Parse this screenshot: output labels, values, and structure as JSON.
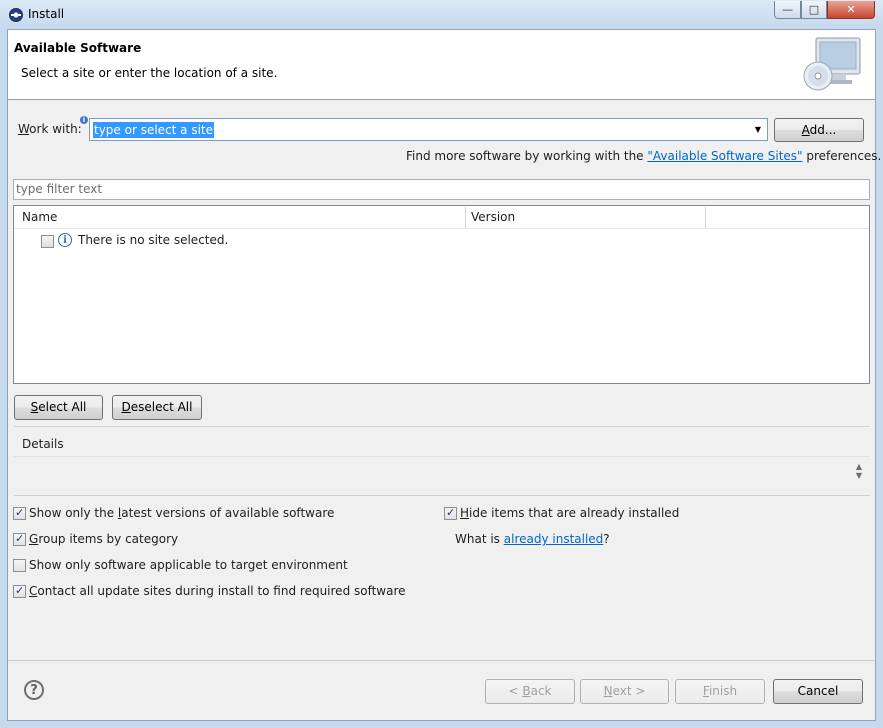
{
  "window": {
    "title": "Install"
  },
  "header": {
    "title": "Available Software",
    "description": "Select a site or enter the location of a site."
  },
  "work_with": {
    "label_accel": "W",
    "label_rest": "ork with:",
    "value": "type or select a site",
    "add_accel": "A",
    "add_rest": "dd..."
  },
  "find_more": {
    "prefix": "Find more software by working with the ",
    "link": "\"Available Software Sites\"",
    "suffix": " preferences."
  },
  "filter": {
    "placeholder": "type filter text"
  },
  "table": {
    "columns": [
      "Name",
      "Version"
    ],
    "empty_message": "There is no site selected."
  },
  "buttons": {
    "select_all_accel": "S",
    "select_all_rest": "elect All",
    "deselect_all_accel": "D",
    "deselect_all_rest": "eselect All",
    "back": "< ",
    "back_accel": "B",
    "back_rest": "ack",
    "next_accel": "N",
    "next_rest": "ext >",
    "finish_accel": "F",
    "finish_rest": "inish",
    "cancel": "Cancel"
  },
  "details": {
    "label": "Details"
  },
  "options": {
    "latest": {
      "pre": "Show only the ",
      "accel": "l",
      "post": "atest versions of available software",
      "checked": true
    },
    "group": {
      "pre": "",
      "accel": "G",
      "post": "roup items by category",
      "checked": true
    },
    "target": {
      "pre": "Show only software applicable to target environment",
      "accel": "",
      "post": "",
      "checked": false
    },
    "contact": {
      "pre": "",
      "accel": "C",
      "post": "ontact all update sites during install to find required software",
      "checked": true
    },
    "hide": {
      "pre": "",
      "accel": "H",
      "post": "ide items that are already installed",
      "checked": true
    },
    "what_is": {
      "prefix": "What is ",
      "link": "already installed",
      "suffix": "?"
    }
  },
  "icons": {
    "app": "eclipse-icon",
    "header": "computer-cd-icon",
    "info": "info-icon",
    "help": "help-icon"
  }
}
